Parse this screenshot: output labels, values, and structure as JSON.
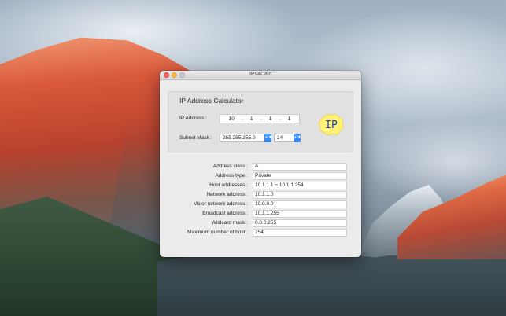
{
  "window": {
    "title": "IPv4Calc"
  },
  "calculator": {
    "heading": "IP Address Calculator",
    "ip_label": "IP Address :",
    "ip_octets": [
      "10",
      "1",
      "1",
      "1"
    ],
    "ip_separator": ".",
    "subnet_label": "Subnet Mask :",
    "subnet_mask_value": "255.255.255.0",
    "cidr_value": "24",
    "badge_text": "IP",
    "badge_color": "#fff176"
  },
  "results": [
    {
      "label": "Address class :",
      "value": "A"
    },
    {
      "label": "Address type :",
      "value": "Private"
    },
    {
      "label": "Host addresses :",
      "value": "10.1.1.1 ~ 10.1.1.254"
    },
    {
      "label": "Network address :",
      "value": "10.1.1.0"
    },
    {
      "label": "Major network address :",
      "value": "10.0.0.0"
    },
    {
      "label": "Broadcast address :",
      "value": "10.1.1.255"
    },
    {
      "label": "Wildcard mask :",
      "value": "0.0.0.255"
    },
    {
      "label": "Maximum number of host :",
      "value": "254"
    }
  ]
}
